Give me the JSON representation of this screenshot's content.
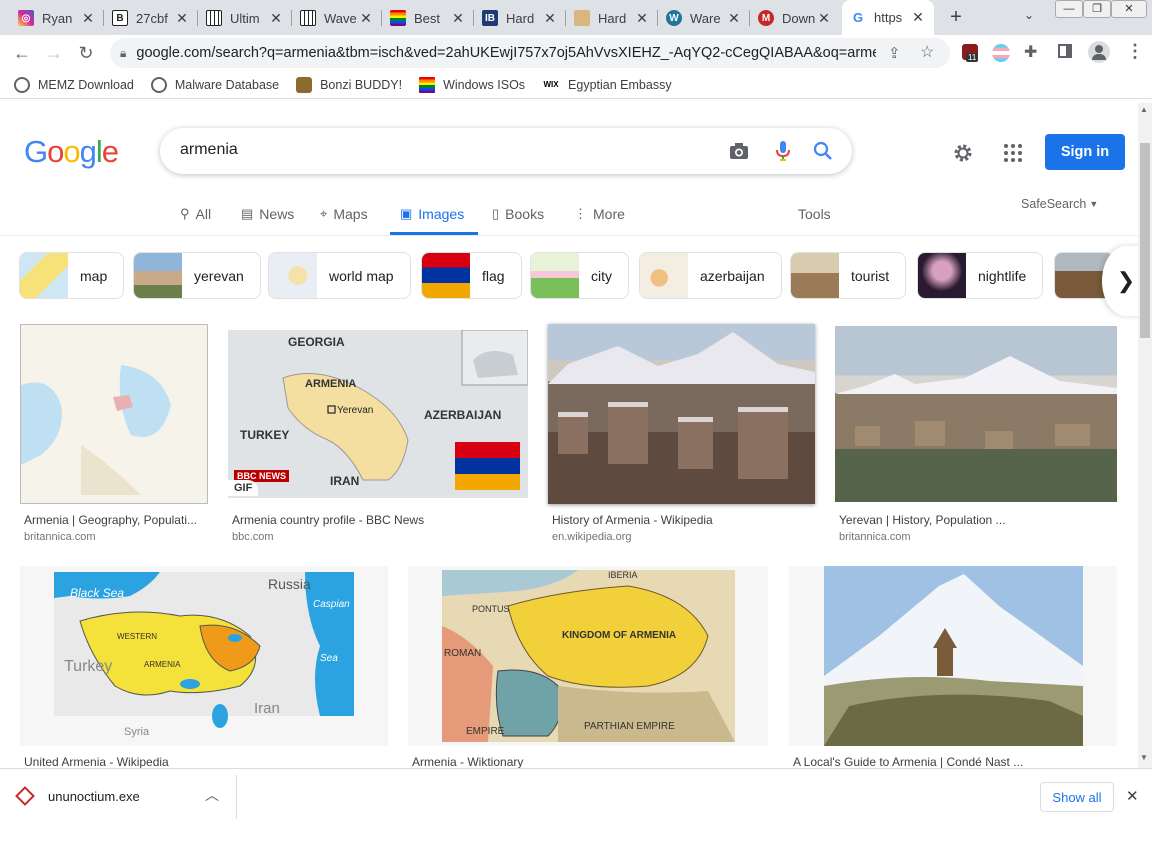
{
  "tabs": [
    {
      "title": "Ryan",
      "icon": "instagram-icon",
      "color": "#d6249f"
    },
    {
      "title": "27cbf",
      "icon": "b-icon",
      "color": "#222222"
    },
    {
      "title": "Ultim",
      "icon": "piano-icon",
      "color": "#333333"
    },
    {
      "title": "Wave",
      "icon": "piano-icon",
      "color": "#333333"
    },
    {
      "title": "Best",
      "icon": "rainbow-flag-icon",
      "color": "#e40303"
    },
    {
      "title": "Hard",
      "icon": "ib-icon",
      "color": "#1f3b73"
    },
    {
      "title": "Hard",
      "icon": "folder-icon",
      "color": "#c8a060"
    },
    {
      "title": "Ware",
      "icon": "wordpress-icon",
      "color": "#21759b"
    },
    {
      "title": "Down",
      "icon": "m-icon",
      "color": "#c62828"
    },
    {
      "title": "https",
      "icon": "google-icon",
      "color": "#4285f4"
    }
  ],
  "new_tab": "+",
  "window": {
    "minimize": "—",
    "restore": "❐",
    "close": "✕"
  },
  "address": "google.com/search?q=armenia&tbm=isch&ved=2ahUKEwjI757x7oj5AhVvsXIEHZ_-AqYQ2-cCegQIABAA&oq=armeni...",
  "extension_badge": "11",
  "bookmarks": [
    {
      "label": "MEMZ Download",
      "icon": "globe-icon"
    },
    {
      "label": "Malware Database",
      "icon": "globe-icon"
    },
    {
      "label": "Bonzi BUDDY!",
      "icon": "bonzi-icon"
    },
    {
      "label": "Windows ISOs",
      "icon": "rainbow-flag-icon"
    },
    {
      "label": "Egyptian Embassy",
      "icon": "wix-icon"
    }
  ],
  "google": {
    "logo": [
      "G",
      "o",
      "o",
      "g",
      "l",
      "e"
    ],
    "logo_colors": [
      "#4285f4",
      "#ea4335",
      "#fbbc05",
      "#4285f4",
      "#34a853",
      "#ea4335"
    ],
    "query": "armenia",
    "sign_in": "Sign in",
    "nav": [
      {
        "label": "All",
        "icon": "search-icon",
        "active": false
      },
      {
        "label": "News",
        "icon": "news-icon",
        "active": false
      },
      {
        "label": "Maps",
        "icon": "map-pin-icon",
        "active": false
      },
      {
        "label": "Images",
        "icon": "image-icon",
        "active": true
      },
      {
        "label": "Books",
        "icon": "book-icon",
        "active": false
      },
      {
        "label": "More",
        "icon": "more-vert-icon",
        "active": false
      }
    ],
    "tools": "Tools",
    "safesearch": "SafeSearch",
    "chips": [
      "map",
      "yerevan",
      "world map",
      "flag",
      "city",
      "azerbaijan",
      "tourist",
      "nightlife"
    ]
  },
  "results": [
    {
      "caption": "Armenia | Geography, Populati...",
      "source": "britannica.com"
    },
    {
      "caption": "Armenia country profile - BBC News",
      "source": "bbc.com",
      "badge": "GIF",
      "map_labels": [
        "GEORGIA",
        "ARMENIA",
        "Yerevan",
        "AZERBAIJAN",
        "TURKEY",
        "IRAN"
      ],
      "logo": "BBC NEWS"
    },
    {
      "caption": "History of Armenia - Wikipedia",
      "source": "en.wikipedia.org"
    },
    {
      "caption": "Yerevan | History, Population ...",
      "source": "britannica.com"
    },
    {
      "caption": "United Armenia - Wikipedia",
      "source": "",
      "map_labels": [
        "Black Sea",
        "Russia",
        "Caspian",
        "Sea",
        "Turkey",
        "ARMENIA",
        "WESTERN",
        "Iran",
        "Syria"
      ]
    },
    {
      "caption": "Armenia - Wiktionary",
      "source": "",
      "map_labels": [
        "KINGDOM OF ARMENIA",
        "PARTHIAN EMPIRE",
        "ROMAN",
        "EMPIRE",
        "PONTUS",
        "IBERIA"
      ]
    },
    {
      "caption": "A Local's Guide to Armenia | Condé Nast ...",
      "source": ""
    }
  ],
  "download": {
    "filename": "ununoctium.exe",
    "show_all": "Show all",
    "close": "✕"
  }
}
